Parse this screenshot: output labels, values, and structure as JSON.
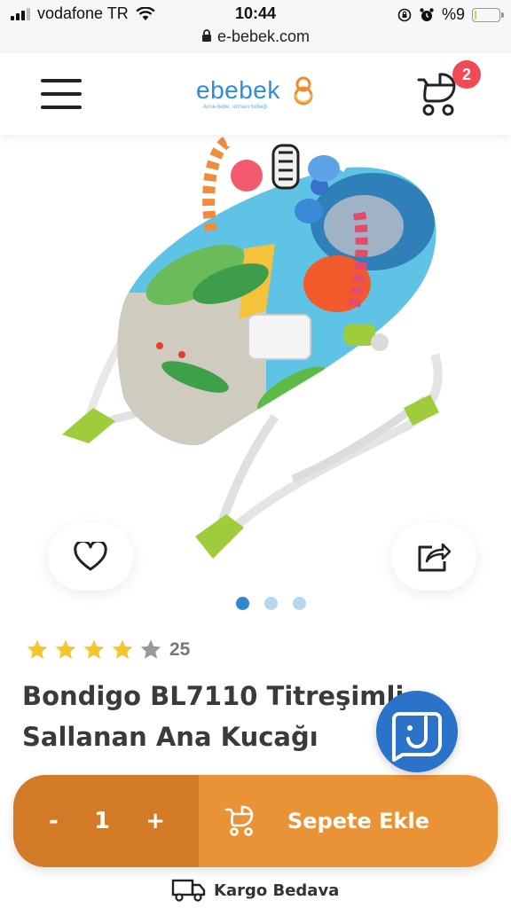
{
  "status_bar": {
    "carrier": "vodafone TR",
    "time": "10:44",
    "url": "e-bebek.com",
    "battery": "%9",
    "battery_level": 0.09
  },
  "header": {
    "logo_text": "ebebek",
    "logo_tagline": "Anne-bebe, uzmanı bebeği",
    "cart_count": "2"
  },
  "product": {
    "image_dots": 3,
    "active_dot": 0,
    "rating": 4,
    "rating_max": 5,
    "review_count": "25",
    "title": "Bondigo BL7110 Titreşimli Sallanan Ana Kucağı"
  },
  "cart_bar": {
    "minus": "-",
    "quantity": "1",
    "plus": "+",
    "add_label": "Sepete Ekle"
  },
  "shipping": {
    "label": "Kargo Bedava"
  },
  "colors": {
    "brand_blue": "#2a8fd6",
    "cart_orange": "#ea9236",
    "qty_orange": "#d27a26",
    "badge_red": "#f04a54",
    "chat_blue": "#2a73c9"
  }
}
